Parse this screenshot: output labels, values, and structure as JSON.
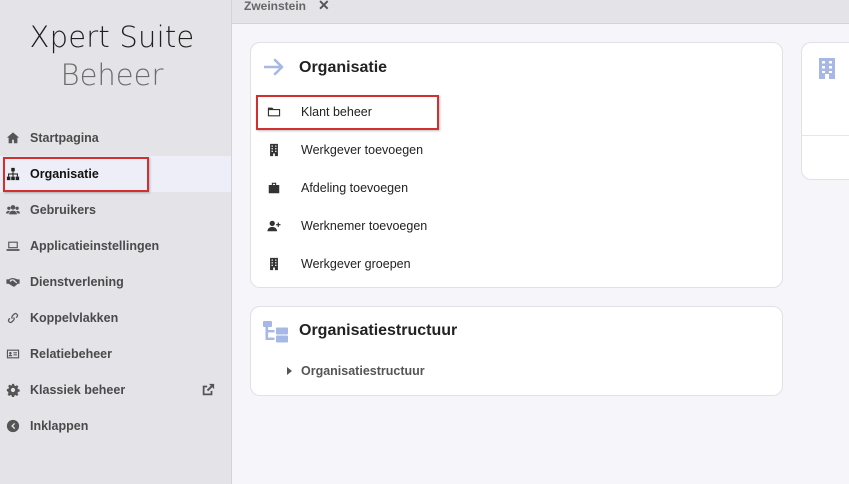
{
  "brand": {
    "line1": "Xpert Suite",
    "line2": "Beheer"
  },
  "nav": {
    "items": [
      {
        "label": "Startpagina",
        "icon": "home-icon"
      },
      {
        "label": "Organisatie",
        "icon": "sitemap-icon"
      },
      {
        "label": "Gebruikers",
        "icon": "users-icon"
      },
      {
        "label": "Applicatieinstellingen",
        "icon": "laptop-icon"
      },
      {
        "label": "Dienstverlening",
        "icon": "handshake-icon"
      },
      {
        "label": "Koppelvlakken",
        "icon": "link-icon"
      },
      {
        "label": "Relatiebeheer",
        "icon": "id-card-icon"
      },
      {
        "label": "Klassiek beheer",
        "icon": "gear-icon"
      },
      {
        "label": "Inklappen",
        "icon": "chevron-left-circle-icon"
      }
    ],
    "active": "Organisatie"
  },
  "tabs": [
    {
      "label": "Zweinstein",
      "close": "✕"
    }
  ],
  "organisatie_card": {
    "title": "Organisatie",
    "links": [
      {
        "label": "Klant beheer",
        "icon": "folder-icon"
      },
      {
        "label": "Werkgever toevoegen",
        "icon": "building-icon"
      },
      {
        "label": "Afdeling toevoegen",
        "icon": "briefcase-icon"
      },
      {
        "label": "Werknemer toevoegen",
        "icon": "user-plus-icon"
      },
      {
        "label": "Werkgever groepen",
        "icon": "building-icon"
      }
    ]
  },
  "structuur_card": {
    "title": "Organisatiestructuur",
    "tree": [
      {
        "label": "Organisatiestructuur"
      }
    ]
  },
  "colors": {
    "accent": "#a7b8e6",
    "highlight": "#d32f2f",
    "sidebar_bg": "#e4e4e8"
  }
}
